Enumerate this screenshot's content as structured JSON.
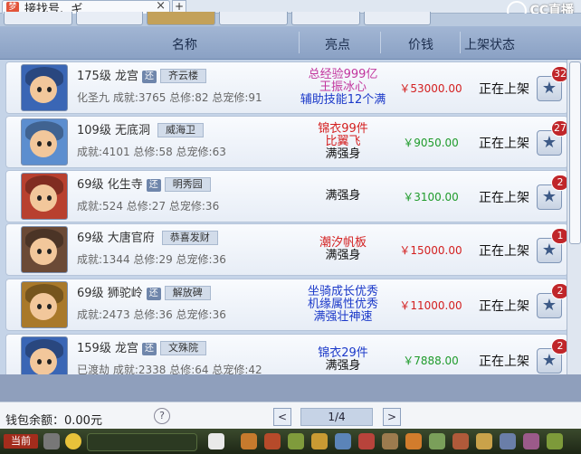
{
  "window": {
    "title": "接找号.  ギ",
    "close_glyph": "×",
    "newtab_glyph": "+",
    "brand_text": "CC直播"
  },
  "columns": {
    "name": "名称",
    "highlight": "亮点",
    "price": "价钱",
    "status": "上架状态"
  },
  "rows": [
    {
      "level": "175级",
      "school": "龙宫",
      "tag": "还",
      "server": "齐云楼",
      "line2": "化圣九  成就:3765  总修:82  总宠修:91",
      "highlights": [
        {
          "text": "总经验999亿",
          "color": "#c2369e"
        },
        {
          "text": "王振冰心",
          "color": "#c2369e"
        },
        {
          "text": "辅助技能12个满",
          "color": "#1b39c9"
        }
      ],
      "price": "￥53000.00",
      "price_color": "#d32020",
      "status": "正在上架",
      "favorites": "32",
      "avatar": "#3a66b5"
    },
    {
      "level": "109级",
      "school": "无底洞",
      "tag": "",
      "server": "威海卫",
      "line2": "成就:4101  总修:58  总宠修:63",
      "highlights": [
        {
          "text": "锦衣99件",
          "color": "#d42020"
        },
        {
          "text": "比翼飞",
          "color": "#d42020"
        },
        {
          "text": "满强身",
          "color": "#111111"
        }
      ],
      "price": "￥9050.00",
      "price_color": "#1f9b2b",
      "status": "正在上架",
      "favorites": "27",
      "avatar": "#5c8ecf"
    },
    {
      "level": "69级",
      "school": "化生寺",
      "tag": "还",
      "server": "明秀园",
      "line2": "成就:524  总修:27  总宠修:36",
      "highlights": [
        {
          "text": "满强身",
          "color": "#111111"
        }
      ],
      "price": "￥3100.00",
      "price_color": "#1f9b2b",
      "status": "正在上架",
      "favorites": "2",
      "avatar": "#b8402f"
    },
    {
      "level": "69级",
      "school": "大唐官府",
      "tag": "",
      "server": "恭喜发财",
      "line2": "成就:1344  总修:29  总宠修:36",
      "highlights": [
        {
          "text": "潮汐帆板",
          "color": "#d42020"
        },
        {
          "text": "满强身",
          "color": "#111111"
        }
      ],
      "price": "￥15000.00",
      "price_color": "#d32020",
      "status": "正在上架",
      "favorites": "1",
      "avatar": "#6b4a36"
    },
    {
      "level": "69级",
      "school": "狮驼岭",
      "tag": "还",
      "server": "解放碑",
      "line2": "成就:2473  总修:36  总宠修:36",
      "highlights": [
        {
          "text": "坐骑成长优秀",
          "color": "#1b39c9"
        },
        {
          "text": "机缘属性优秀",
          "color": "#1b39c9"
        },
        {
          "text": "满强壮神速",
          "color": "#1b39c9"
        }
      ],
      "price": "￥11000.00",
      "price_color": "#d32020",
      "status": "正在上架",
      "favorites": "2",
      "avatar": "#a9792a"
    },
    {
      "level": "159级",
      "school": "龙宫",
      "tag": "还",
      "server": "文殊院",
      "line2": "已渡劫  成就:2338  总修:64  总宠修:42",
      "highlights": [
        {
          "text": "锦衣29件",
          "color": "#1b39c9"
        },
        {
          "text": "满强身",
          "color": "#111111"
        }
      ],
      "price": "￥7888.00",
      "price_color": "#1f9b2b",
      "status": "正在上架",
      "favorites": "2",
      "avatar": "#3a66b5"
    }
  ],
  "footer": {
    "wallet": "钱包余额：0.00元",
    "help_glyph": "?",
    "prev_glyph": "<",
    "next_glyph": ">",
    "page": "1/4"
  },
  "taskbar": {
    "current": "当前"
  },
  "icons": {
    "favorite": "★"
  }
}
